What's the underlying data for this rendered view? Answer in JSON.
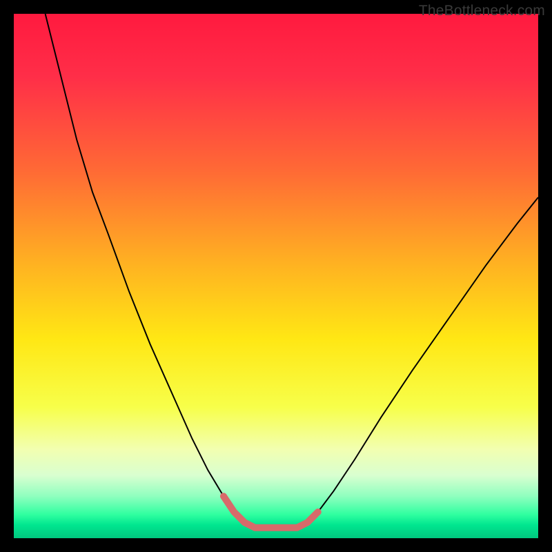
{
  "watermark": "TheBottleneck.com",
  "chart_data": {
    "type": "line",
    "title": "",
    "xlabel": "",
    "ylabel": "",
    "xlim": [
      0,
      100
    ],
    "ylim": [
      0,
      100
    ],
    "gradient_stops": [
      {
        "offset": 0.0,
        "color": "#ff1a3f"
      },
      {
        "offset": 0.12,
        "color": "#ff2e48"
      },
      {
        "offset": 0.3,
        "color": "#ff6a35"
      },
      {
        "offset": 0.48,
        "color": "#ffb321"
      },
      {
        "offset": 0.62,
        "color": "#ffe714"
      },
      {
        "offset": 0.75,
        "color": "#f7ff4a"
      },
      {
        "offset": 0.83,
        "color": "#f2ffb0"
      },
      {
        "offset": 0.88,
        "color": "#d9ffd0"
      },
      {
        "offset": 0.92,
        "color": "#8fffbf"
      },
      {
        "offset": 0.955,
        "color": "#2fffa0"
      },
      {
        "offset": 0.975,
        "color": "#00e68f"
      },
      {
        "offset": 1.0,
        "color": "#00c87f"
      }
    ],
    "series": [
      {
        "name": "bottleneck-curve",
        "color": "#000000",
        "width": 2,
        "x": [
          6,
          8,
          10,
          12,
          15,
          18,
          22,
          26,
          30,
          34,
          37,
          40,
          42,
          44,
          46,
          50,
          54,
          56,
          58,
          61,
          65,
          70,
          76,
          83,
          90,
          96,
          100
        ],
        "y": [
          100,
          92,
          84,
          76,
          66,
          58,
          47,
          37,
          28,
          19,
          13,
          8,
          5,
          3,
          2,
          2,
          2,
          3,
          5,
          9,
          15,
          23,
          32,
          42,
          52,
          60,
          65
        ]
      },
      {
        "name": "valley-highlight",
        "color": "#d86a6a",
        "width": 10,
        "linecap": "round",
        "x": [
          40,
          42,
          44,
          46,
          50,
          54,
          56,
          58
        ],
        "y": [
          8,
          5,
          3,
          2,
          2,
          2,
          3,
          5
        ]
      }
    ]
  }
}
